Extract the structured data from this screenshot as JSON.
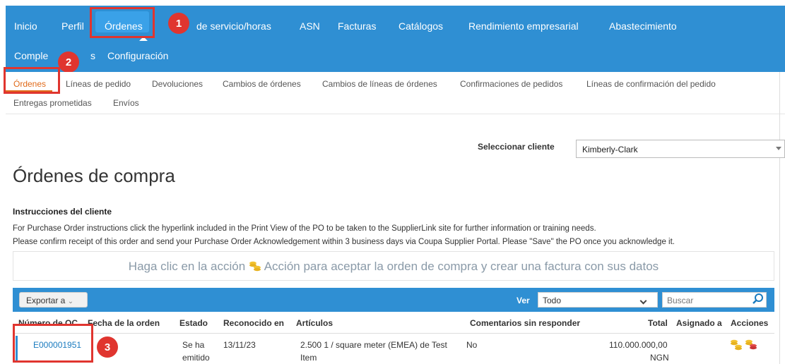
{
  "nav": {
    "items": [
      "Inicio",
      "Perfil",
      "Órdenes",
      "de servicio/horas",
      "ASN",
      "Facturas",
      "Catálogos",
      "Rendimiento empresarial",
      "Abastecimiento"
    ],
    "row2": [
      "Complementos",
      "Configuración"
    ],
    "complementos_visible": "Comple",
    "complementos_tail": "s"
  },
  "callouts": [
    "1",
    "2",
    "3"
  ],
  "subnav": {
    "items": [
      "Órdenes",
      "Líneas de pedido",
      "Devoluciones",
      "Cambios de órdenes",
      "Cambios de líneas de órdenes",
      "Confirmaciones de pedidos",
      "Líneas de confirmación del pedido"
    ],
    "row2": [
      "Entregas prometidas",
      "Envíos"
    ]
  },
  "client_select": {
    "label": "Seleccionar cliente",
    "value": "Kimberly-Clark"
  },
  "page_title": "Órdenes de compra",
  "instructions": {
    "heading": "Instrucciones del cliente",
    "lines": [
      "For Purchase Order instructions click the hyperlink included in the Print View of the PO to be taken to the SupplierLink site for further information or training needs.",
      "Please confirm receipt of this order and send your Purchase Order Acknowledgement within 3 business days via Coupa Supplier Portal. Please \"Save\" the PO once you acknowledge it."
    ]
  },
  "banner": {
    "text_before": "Haga clic en la acción",
    "text_after": "Acción para aceptar la orden de compra y crear una factura con sus datos"
  },
  "toolbar": {
    "export_label": "Exportar a",
    "ver_label": "Ver",
    "ver_value": "Todo",
    "search_placeholder": "Buscar"
  },
  "table": {
    "headers": [
      "Número de OC",
      "Fecha de la orden",
      "Estado",
      "Reconocido en",
      "Artículos",
      "Comentarios sin responder",
      "Total",
      "Asignado a",
      "Acciones"
    ],
    "row": {
      "po_number": "E000001951",
      "status_line1": "Se ha",
      "status_line2": "emitido",
      "acknowledged": "13/11/23",
      "items_line1": "2.500 1 / square meter (EMEA) de Test",
      "items_line2": "Item",
      "comments": "No",
      "total_line1": "110.000.000,00",
      "total_line2": "NGN"
    }
  },
  "colors": {
    "nav_bg": "#2f8fd3",
    "nav_active": "#3aa1e8",
    "callout_red": "#e0352f",
    "sub_active": "#e06a1a",
    "link": "#1a7bbf"
  }
}
